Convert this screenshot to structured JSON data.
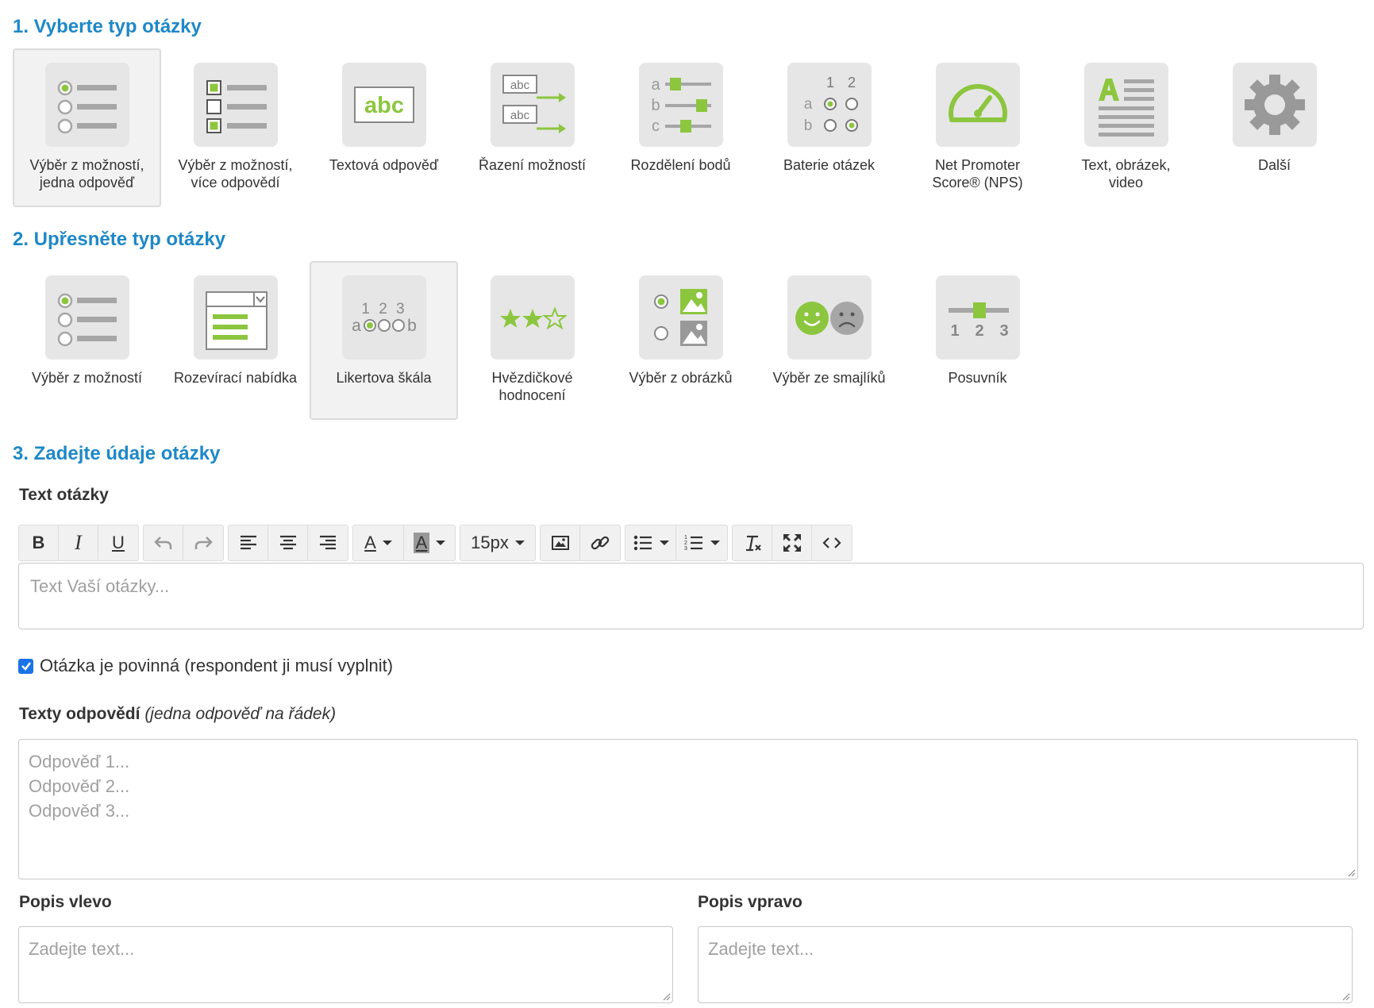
{
  "step1": {
    "title": "1. Vyberte typ otázky",
    "tiles": [
      {
        "label": "Výběr z možností,\njedna odpověď",
        "icon": "single-choice-icon",
        "selected": true
      },
      {
        "label": "Výběr z možností,\nvíce odpovědí",
        "icon": "multiple-choice-icon",
        "selected": false
      },
      {
        "label": "Textová odpověď",
        "icon": "text-answer-icon",
        "selected": false
      },
      {
        "label": "Řazení možností",
        "icon": "ranking-icon",
        "selected": false
      },
      {
        "label": "Rozdělení bodů",
        "icon": "points-distribution-icon",
        "selected": false
      },
      {
        "label": "Baterie otázek",
        "icon": "question-battery-icon",
        "selected": false
      },
      {
        "label": "Net Promoter\nScore® (NPS)",
        "icon": "nps-gauge-icon",
        "selected": false
      },
      {
        "label": "Text, obrázek,\nvideo",
        "icon": "text-image-video-icon",
        "selected": false
      },
      {
        "label": "Další",
        "icon": "gear-icon",
        "selected": false
      }
    ]
  },
  "step2": {
    "title": "2. Upřesněte typ otázky",
    "tiles": [
      {
        "label": "Výběr z možností",
        "icon": "radio-list-icon",
        "selected": false
      },
      {
        "label": "Rozevírací nabídka",
        "icon": "dropdown-icon",
        "selected": false
      },
      {
        "label": "Likertova škála",
        "icon": "likert-scale-icon",
        "selected": true
      },
      {
        "label": "Hvězdičkové\nhodnocení",
        "icon": "star-rating-icon",
        "selected": false
      },
      {
        "label": "Výběr z obrázků",
        "icon": "image-choice-icon",
        "selected": false
      },
      {
        "label": "Výběr ze smajlíků",
        "icon": "smiley-choice-icon",
        "selected": false
      },
      {
        "label": "Posuvník",
        "icon": "slider-icon",
        "selected": false
      }
    ],
    "likert_text": "1 2 3",
    "likert_ends": [
      "a",
      "b"
    ],
    "battery_text": [
      "1",
      "2",
      "a",
      "b"
    ],
    "slider_text": [
      "1",
      "2",
      "3"
    ],
    "points_text": [
      "a",
      "b",
      "c"
    ],
    "abc_text": "abc"
  },
  "step3": {
    "title": "3. Zadejte údaje otázky",
    "question_label": "Text otázky",
    "toolbar": {
      "bold": "B",
      "italic": "I",
      "underline": "U",
      "font_color": "A",
      "bg_color": "A",
      "font_size": "15px"
    },
    "question_placeholder": "Text Vaší otázky...",
    "required_label": "Otázka je povinná (respondent ji musí vyplnit)",
    "required_checked": true,
    "answers_label": "Texty odpovědí",
    "answers_hint": "(jedna odpověď na řádek)",
    "answers_placeholder": "Odpověď 1...\nOdpověď 2...\nOdpověď 3...",
    "left_label": "Popis vlevo",
    "right_label": "Popis vpravo",
    "left_placeholder": "Zadejte text...",
    "right_placeholder": "Zadejte text..."
  },
  "colors": {
    "accent": "#1e88c7",
    "green": "#8cc63f",
    "gray": "#a6a6a6",
    "tile_bg": "#e6e6e6"
  }
}
